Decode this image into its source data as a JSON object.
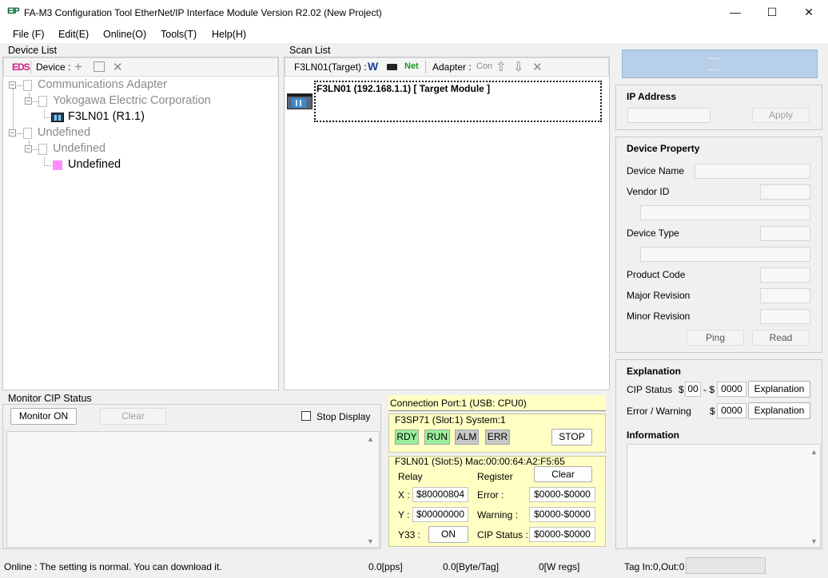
{
  "window": {
    "icon_text": "EIP",
    "title": "FA-M3 Configuration Tool EtherNet/IP Interface Module Version R2.02 (New Project)",
    "minimize": "—",
    "maximize": "☐",
    "close": "✕"
  },
  "menu": {
    "file": "File (F)",
    "edit": "Edit(E)",
    "online": "Online(O)",
    "tools": "Tools(T)",
    "help": "Help(H)"
  },
  "device_list": {
    "label": "Device List",
    "eds_label": "EDS",
    "device_label": "Device :",
    "tree": {
      "comm_adapter": "Communications Adapter",
      "yokogawa": "Yokogawa Electric Corporation",
      "f3ln01": "F3LN01  (R1.1)",
      "undefined1": "Undefined",
      "undefined2": "Undefined",
      "undefined3": "Undefined"
    }
  },
  "scan_list": {
    "label": "Scan List",
    "target_label": "F3LN01(Target) :",
    "w_label": "W",
    "net_label": "Net",
    "adapter_label": "Adapter :",
    "con_label": "Con",
    "module_text": "F3LN01 (192.168.1.1)  [ Target Module ]"
  },
  "right_panel": {
    "header_line1": "-----",
    "header_line2": "-----",
    "ip_title": "IP Address",
    "apply": "Apply",
    "device_property_title": "Device Property",
    "device_name": "Device Name",
    "vendor_id": "Vendor ID",
    "device_type": "Device Type",
    "product_code": "Product Code",
    "major_revision": "Major Revision",
    "minor_revision": "Minor Revision",
    "ping": "Ping",
    "read": "Read",
    "explanation_title": "Explanation",
    "cip_status_label": "CIP Status",
    "dollar": "$",
    "cip_status_val1": "00",
    "cip_dash": "- $",
    "cip_status_val2": "0000",
    "explanation_btn": "Explanation",
    "error_warning_label": "Error / Warning",
    "error_warning_val": "0000",
    "information_title": "Information"
  },
  "monitor": {
    "label": "Monitor CIP Status",
    "monitor_on": "Monitor ON",
    "clear": "Clear",
    "stop_display": "Stop Display"
  },
  "connection": {
    "port": "Connection Port:1 (USB: CPU0)",
    "cpu_module": "F3SP71 (Slot:1)  System:1",
    "rdy": "RDY",
    "run": "RUN",
    "alm": "ALM",
    "err": "ERR",
    "stop": "STOP",
    "ln_module": "F3LN01 (Slot:5)  Mac:00:00:64:A2:F5:65",
    "relay": "Relay",
    "register": "Register",
    "clear": "Clear",
    "x_label": "X :",
    "x_val": "$80000804",
    "y_label": "Y :",
    "y_val": "$00000000",
    "y33_label": "Y33 :",
    "on": "ON",
    "error_label": "Error :",
    "error_val": "$0000-$0000",
    "warning_label": "Warning :",
    "warning_val": "$0000-$0000",
    "cip_label": "CIP Status :",
    "cip_val": "$0000-$0000"
  },
  "statusbar": {
    "message": "Online : The setting is normal. You can download it.",
    "pps": "0.0[pps]",
    "byte_tag": "0.0[Byte/Tag]",
    "w_regs": "0[W regs]",
    "tag_inout": "Tag In:0,Out:0"
  },
  "colors": {
    "rdy": "#9af09a",
    "run": "#9af09a",
    "alm": "#c8c8c8",
    "err": "#c8c8c8",
    "header_blue": "#b7cfe8",
    "yellow_panel": "#ffffc4",
    "pink_icon": "#ff8cff"
  }
}
